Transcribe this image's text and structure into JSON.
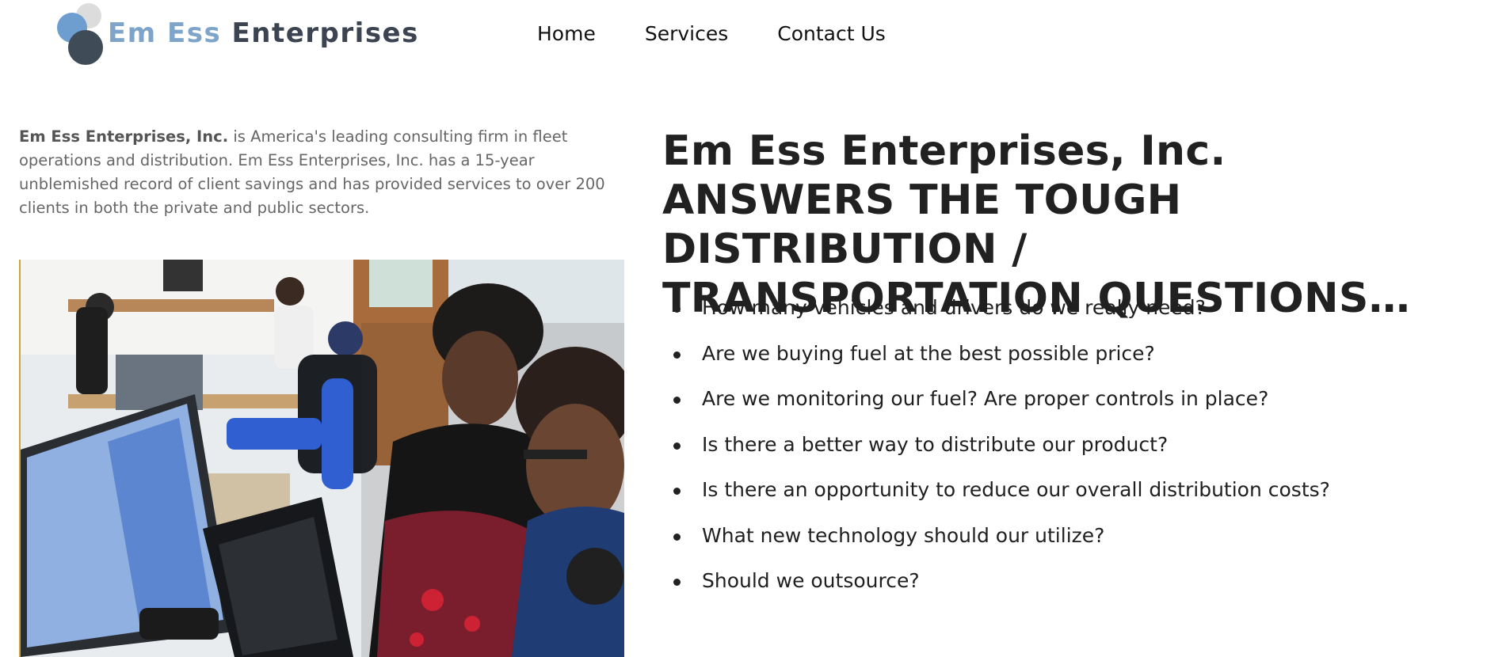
{
  "brand": {
    "name_part1": "Em Ess",
    "name_part2": "Enterprises",
    "colors": {
      "light_blue": "#7ea4c9",
      "dark_slate": "#3b4450"
    }
  },
  "nav": {
    "items": [
      {
        "label": "Home"
      },
      {
        "label": "Services"
      },
      {
        "label": "Contact Us"
      }
    ]
  },
  "intro": {
    "company": "Em Ess Enterprises, Inc.",
    "text": " is America's leading consulting firm in fleet operations and distribution. Em Ess Enterprises, Inc. has a 15-year unblemished record of client savings and has provided services to over 200 clients in both the private and public sectors."
  },
  "main": {
    "headline": "Em Ess Enterprises, Inc. ANSWERS THE TOUGH DISTRIBUTION / TRANSPORTATION QUESTIONS…",
    "questions": [
      "How many vehicles and drivers do we really need?",
      "Are we buying fuel at the best possible price?",
      "Are we monitoring our fuel? Are proper controls in place?",
      "Is there a better way to distribute our product?",
      "Is there an opportunity to reduce our overall distribution costs?",
      "What new technology should our utilize?",
      "Should we outsource?"
    ]
  }
}
